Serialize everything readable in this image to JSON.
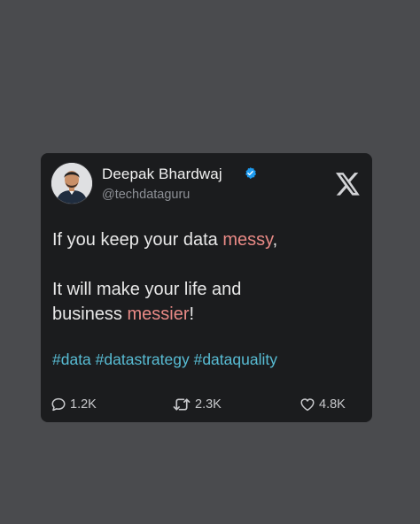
{
  "tweet": {
    "author": {
      "name": "Deepak Bhardwaj",
      "handle": "@techdataguru",
      "verified": true
    },
    "platform_icon": "x-logo-icon",
    "body": {
      "line1_pre": "If you keep your data ",
      "line1_hl": "messy",
      "line1_post": ",",
      "line2": "It will make your life and",
      "line3_pre": "business ",
      "line3_hl": "messier",
      "line3_post": "!"
    },
    "hashtags": [
      "#data",
      "#datastrategy",
      "#dataquality"
    ],
    "stats": {
      "replies": "1.2K",
      "retweets": "2.3K",
      "likes": "4.8K"
    }
  },
  "colors": {
    "background": "#4a4b4e",
    "card": "#1b1c1e",
    "highlight": "#e98a86",
    "hashtag": "#58bcd4",
    "verified": "#1d9bf0"
  }
}
